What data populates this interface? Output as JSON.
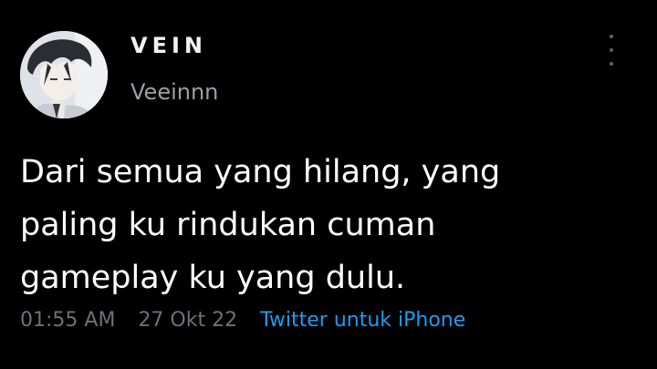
{
  "author": {
    "display_name": "VEIN",
    "handle": "Veeinnn",
    "avatar_icon": "anime-portrait-avatar"
  },
  "menu": {
    "icon": "more-vertical-icon"
  },
  "tweet": {
    "lines": [
      "Dari semua yang hilang, yang",
      "paling ku rindukan cuman",
      "gameplay ku yang dulu."
    ]
  },
  "meta": {
    "time": "01:55 AM",
    "date": "27 Okt 22",
    "source": "Twitter untuk iPhone"
  },
  "colors": {
    "background": "#000000",
    "text_primary": "#ffffff",
    "text_secondary": "#6e7276",
    "link": "#1d9bf0"
  }
}
